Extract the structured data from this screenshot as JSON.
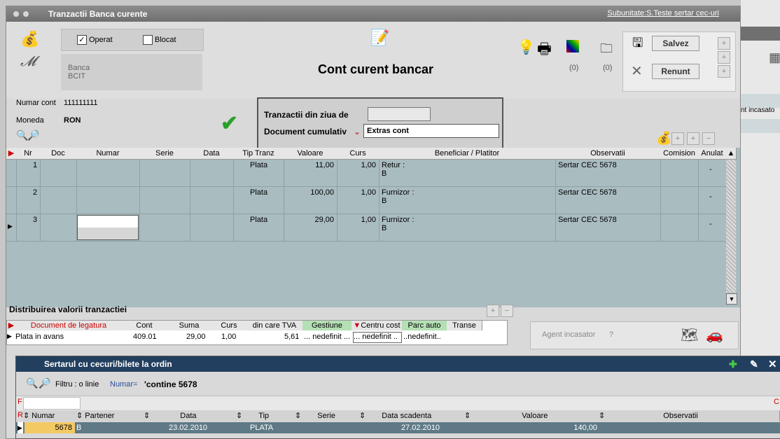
{
  "window": {
    "title": "Tranzactii Banca curente",
    "subunit": "Subunitate:S.Teste sertar cec-uri"
  },
  "status": {
    "operat_label": "Operat",
    "operat_checked": true,
    "blocat_label": "Blocat",
    "blocat_checked": false
  },
  "bank": {
    "label": "Banca",
    "value": "BCIT"
  },
  "heading": "Cont curent bancar",
  "counters": {
    "left": "(0)",
    "right": "(0)"
  },
  "buttons": {
    "save": "Salvez",
    "cancel": "Renunt"
  },
  "account": {
    "numar_label": "Numar cont",
    "numar_value": "111111111",
    "moneda_label": "Moneda",
    "moneda_value": "RON"
  },
  "trz_panel": {
    "zi_label": "Tranzactii din ziua de",
    "doc_label": "Document cumulativ",
    "doc_value": "Extras cont"
  },
  "grid": {
    "columns": [
      "Nr",
      "Doc",
      "Numar",
      "Serie",
      "Data",
      "Tip Tranz",
      "Valoare",
      "Curs",
      "Beneficiar / Platitor",
      "Observatii",
      "Comision",
      "Anulat"
    ],
    "rows": [
      {
        "nr": "1",
        "tip": "Plata",
        "valoare": "11,00",
        "curs": "1,00",
        "ben1": "Retur :",
        "ben2": "B",
        "obs": "Sertar CEC 5678",
        "anulat": "-"
      },
      {
        "nr": "2",
        "tip": "Plata",
        "valoare": "100,00",
        "curs": "1,00",
        "ben1": "Furnizor :",
        "ben2": "B",
        "obs": "Sertar CEC 5678",
        "anulat": "-"
      },
      {
        "nr": "3",
        "tip": "Plata",
        "valoare": "29,00",
        "curs": "1,00",
        "ben1": "Furnizor :",
        "ben2": "B",
        "obs": "Sertar CEC 5678",
        "anulat": "-"
      }
    ]
  },
  "dist": {
    "title": "Distribuirea valorii tranzactiei",
    "columns": [
      "Document de legatura",
      "Cont",
      "Suma",
      "Curs",
      "din care TVA",
      "Gestiune",
      "Centru cost",
      "Parc auto",
      "Transe"
    ],
    "row": {
      "doc": "Plata in avans",
      "cont": "409.01",
      "suma": "29,00",
      "curs": "1,00",
      "tva": "5,61",
      "gest": "... nedefinit ...",
      "centru": "... nedefinit ..",
      "parc": "..nedefinit.."
    }
  },
  "agent": {
    "label": "Agent incasator",
    "q": "?"
  },
  "right_text": "nt incasato",
  "sertar": {
    "title": "Sertarul cu cecuri/bilete la ordin",
    "filter_label": "Filtru : o linie",
    "filter_field": "Numar=",
    "filter_value": "'contine 5678",
    "col_f": "F",
    "col_r": "R",
    "col_c": "C",
    "columns": [
      "Numar",
      "Partener",
      "Data",
      "Tip",
      "Serie",
      "Data scadenta",
      "Valoare",
      "Observatii"
    ],
    "row": {
      "numar": "5678",
      "partener": "B",
      "data": "23.02.2010",
      "tip": "PLATA",
      "serie": "",
      "scad": "27.02.2010",
      "valoare": "140,00",
      "obs": ""
    }
  }
}
